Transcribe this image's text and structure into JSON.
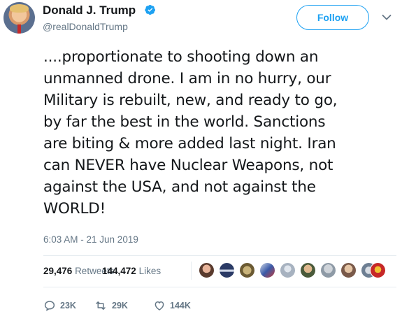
{
  "author": {
    "display_name": "Donald J. Trump",
    "handle": "@realDonaldTrump",
    "verified_icon": "verified-badge-icon"
  },
  "header": {
    "follow_label": "Follow",
    "menu_icon": "chevron-down-icon"
  },
  "tweet": {
    "text": "....proportionate to shooting down an\nunmanned drone. I am in no hurry, our\nMilitary is rebuilt, new,  and ready to go,\nby far the best in the world. Sanctions\nare biting & more added last night. Iran\ncan NEVER have Nuclear Weapons, not\nagainst the USA, and not against the\nWORLD!",
    "timestamp": "6:03 AM - 21 Jun 2019"
  },
  "stats": {
    "retweets_count": "29,476",
    "retweets_label": "Retweets",
    "likes_count": "144,472",
    "likes_label": "Likes"
  },
  "likers_count_shown": 10,
  "actions": {
    "replies": "23K",
    "retweets": "29K",
    "likes": "144K"
  },
  "colors": {
    "accent": "#1da1f2",
    "muted": "#657786",
    "text": "#14171a"
  }
}
